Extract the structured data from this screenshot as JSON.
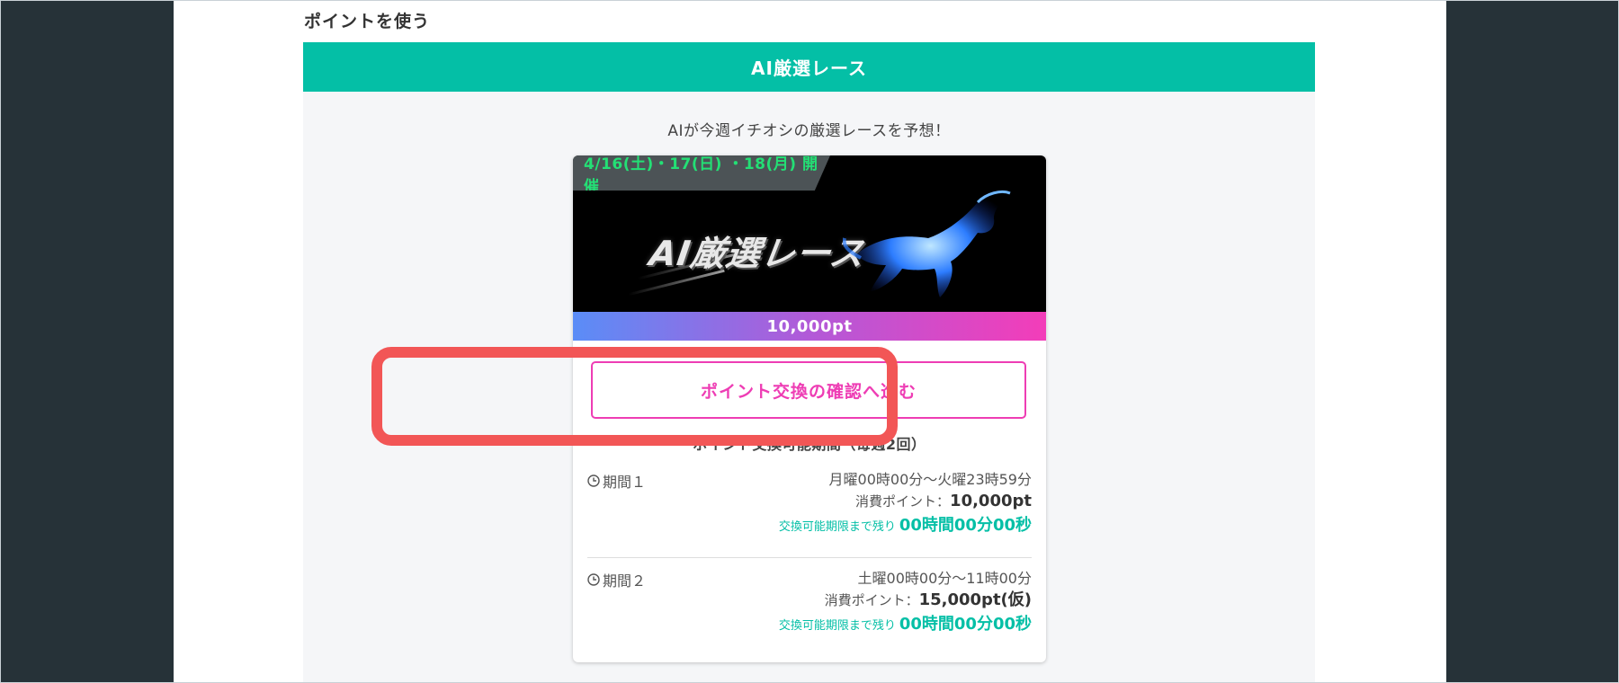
{
  "page": {
    "section_title": "ポイントを使う",
    "banner_title": "AI厳選レース",
    "lead_text": "AIが今週イチオシの厳選レースを予想！"
  },
  "card": {
    "date_tag": "4/16(土)・17(日) ・18(月) 開催",
    "hero_title": "AI厳選レース",
    "price": "10,000pt",
    "cta_label": "ポイント交換の確認へ進む",
    "period_title": "ポイント交換可能期間（毎週2回）",
    "periods": [
      {
        "label": "期間１",
        "time": "月曜00時00分〜火曜23時59分",
        "cost_label": "消費ポイント：",
        "cost_value": "10,000pt",
        "remain_label": "交換可能期限まで残り",
        "remain_value": "00時間00分00秒"
      },
      {
        "label": "期間２",
        "time": "土曜00時00分〜11時00分",
        "cost_label": "消費ポイント：",
        "cost_value": "15,000pt(仮)",
        "remain_label": "交換可能期限まで残り",
        "remain_value": "00時間00分00秒"
      }
    ]
  },
  "colors": {
    "sidebar": "#263238",
    "accent_teal": "#04bfa6",
    "cta_pink": "#ee3db4",
    "highlight_red": "#f25656",
    "date_green": "#23e075"
  },
  "icons": {
    "period_icon": "clock-icon",
    "hero_image": "blue-flame-horse-icon"
  }
}
